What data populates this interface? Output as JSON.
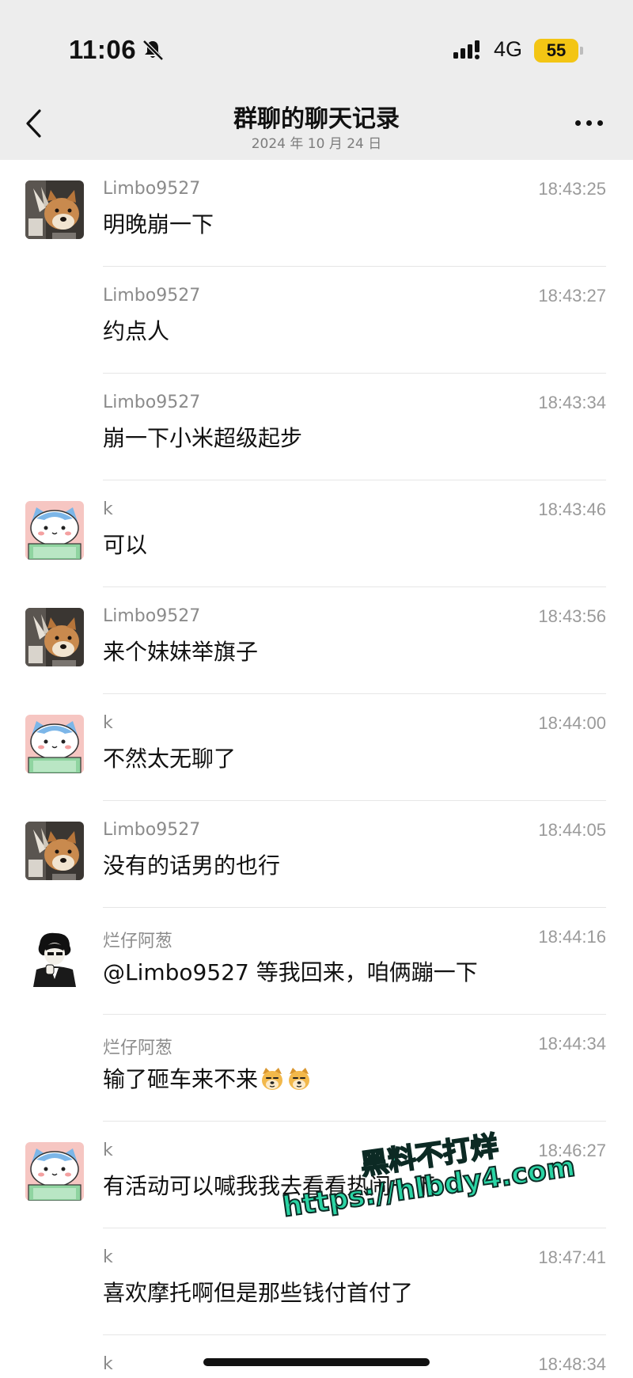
{
  "status_bar": {
    "time": "11:06",
    "network": "4G",
    "battery": "55"
  },
  "header": {
    "title": "群聊的聊天记录",
    "subtitle": "2024 年 10 月 24 日"
  },
  "messages": [
    {
      "sender": "Limbo9527",
      "time": "18:43:25",
      "text": "明晚崩一下",
      "avatar": "shiba-avatar"
    },
    {
      "sender": "Limbo9527",
      "time": "18:43:27",
      "text": "约点人",
      "avatar": ""
    },
    {
      "sender": "Limbo9527",
      "time": "18:43:34",
      "text": "崩一下小米超级起步",
      "avatar": ""
    },
    {
      "sender": "k",
      "time": "18:43:46",
      "text": "可以",
      "avatar": "cat-avatar"
    },
    {
      "sender": "Limbo9527",
      "time": "18:43:56",
      "text": "来个妹妹举旗子",
      "avatar": "shiba-avatar"
    },
    {
      "sender": "k",
      "time": "18:44:00",
      "text": "不然太无聊了",
      "avatar": "cat-avatar"
    },
    {
      "sender": "Limbo9527",
      "time": "18:44:05",
      "text": "没有的话男的也行",
      "avatar": "shiba-avatar"
    },
    {
      "sender": "烂仔阿葱",
      "time": "18:44:16",
      "text": "@Limbo9527 等我回来，咱俩蹦一下",
      "avatar": "suit-avatar"
    },
    {
      "sender": "烂仔阿葱",
      "time": "18:44:34",
      "text": "输了砸车来不来",
      "avatar": "",
      "emoji": "shiba-face-emoji"
    },
    {
      "sender": "k",
      "time": "18:46:27",
      "text": "有活动可以喊我我去看看热闹一下",
      "avatar": "cat-avatar"
    },
    {
      "sender": "k",
      "time": "18:47:41",
      "text": "喜欢摩托啊但是那些钱付首付了",
      "avatar": ""
    },
    {
      "sender": "k",
      "time": "18:48:34",
      "text": "",
      "avatar": ""
    }
  ],
  "watermark": {
    "line1": "黑料不打烊",
    "line2": "https://hlbdy4.com"
  },
  "colors": {
    "header_bg": "#ededed",
    "battery": "#f3c514",
    "watermark": "#2ad4a4"
  }
}
